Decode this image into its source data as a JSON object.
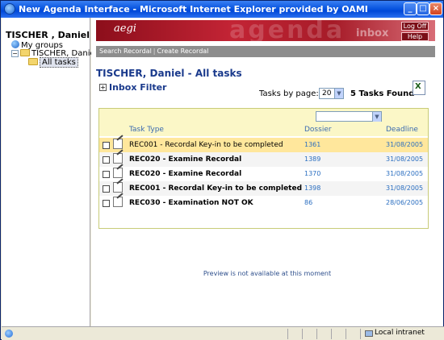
{
  "window": {
    "title": "New Agenda Interface - Microsoft Internet Explorer provided by OAMI",
    "controls": {
      "minimize": "_",
      "maximize": "□",
      "close": "×"
    }
  },
  "sidebar": {
    "user": "TISCHER , Daniel",
    "tree": [
      {
        "label": "My groups",
        "icon": "globe-icon"
      },
      {
        "label": "TISCHER, Daniel",
        "icon": "folder-icon",
        "expander": "−"
      },
      {
        "label": "All tasks",
        "icon": "folder-icon",
        "selected": true
      }
    ]
  },
  "banner": {
    "brand": "aegi",
    "watermark": "agenda",
    "inbox": "inbox",
    "logoff": "Log Off",
    "help": "Help",
    "brand_color": "#a61b28"
  },
  "menu": {
    "items": [
      "Search Recordal",
      "Create Recordal"
    ]
  },
  "main": {
    "title": "TISCHER, Daniel - All tasks",
    "filter_expander": "+",
    "filter_title": "Inbox Filter",
    "tasks_by_page_label": "Tasks by page:",
    "tasks_by_page_value": "20",
    "tasks_found": "5 Tasks Found",
    "export_icon": "excel-export-icon"
  },
  "table": {
    "columns": [
      "Task Type",
      "Dossier",
      "Deadline"
    ],
    "rows": [
      {
        "type": "REC001 - Recordal Key-in to be completed",
        "dossier": "1361",
        "deadline": "31/08/2005",
        "bold": false,
        "highlight": true
      },
      {
        "type": "REC020 - Examine Recordal",
        "dossier": "1389",
        "deadline": "31/08/2005",
        "bold": true,
        "highlight": false
      },
      {
        "type": "REC020 - Examine Recordal",
        "dossier": "1370",
        "deadline": "31/08/2005",
        "bold": true,
        "highlight": false
      },
      {
        "type": "REC001 - Recordal Key-in to be completed",
        "dossier": "1398",
        "deadline": "31/08/2005",
        "bold": true,
        "highlight": false
      },
      {
        "type": "REC030 - Examination NOT OK",
        "dossier": "86",
        "deadline": "28/06/2005",
        "bold": true,
        "highlight": false
      }
    ]
  },
  "preview": "Preview is not available at this moment",
  "status": {
    "zone": "Local intranet"
  }
}
